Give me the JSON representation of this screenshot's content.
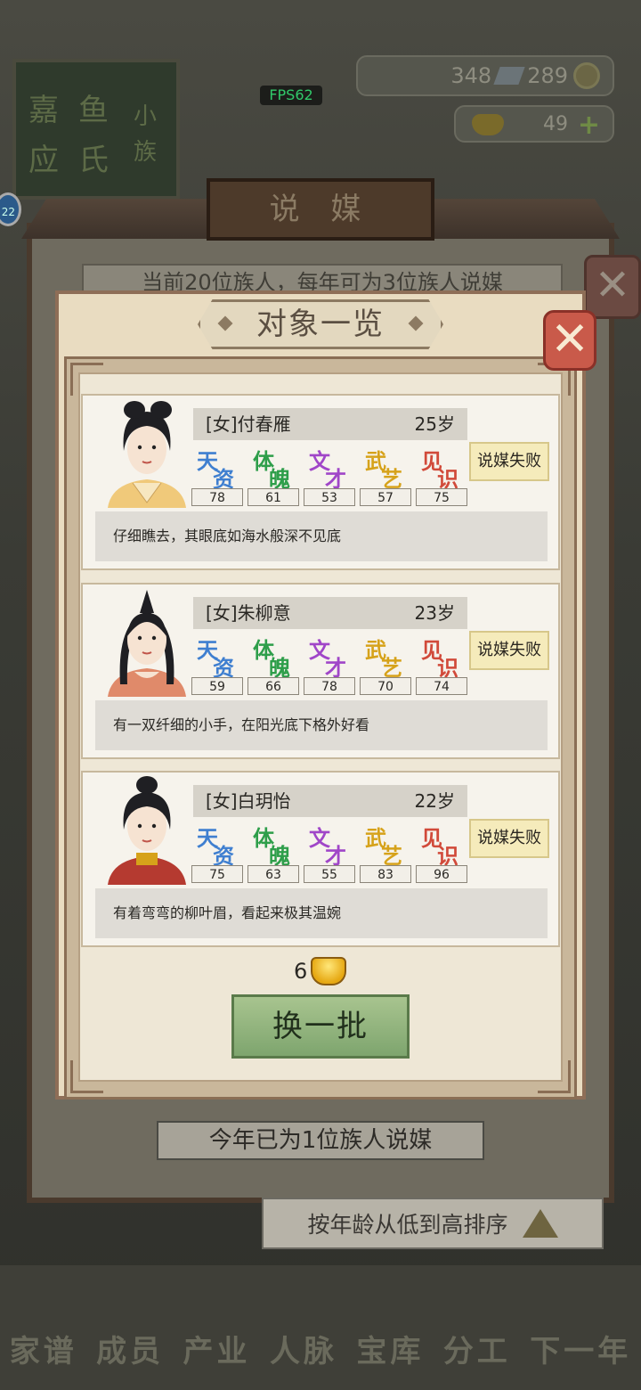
{
  "background": {
    "fps": "FPS62",
    "resources": {
      "copper": "348",
      "silver": "289",
      "gold": "49"
    },
    "plaque_chars": [
      "嘉",
      "鱼",
      "应",
      "氏",
      "小",
      "族"
    ],
    "badge": "22",
    "outer_title": "说 媒",
    "outer_subtitle": "当前20位族人，每年可为3位族人说媒",
    "outer_footer": "今年已为1位族人说媒",
    "sort_label": "按年龄从低到高排序",
    "nav": [
      "家谱",
      "成员",
      "产业",
      "人脉",
      "宝库",
      "分工",
      "下一年"
    ]
  },
  "dialog": {
    "title": "对象一览",
    "stat_labels": [
      {
        "a": "天",
        "b": "资",
        "color": "#3f7fd0"
      },
      {
        "a": "体",
        "b": "魄",
        "color": "#2e9e4a"
      },
      {
        "a": "文",
        "b": "才",
        "color": "#a046c8"
      },
      {
        "a": "武",
        "b": "艺",
        "color": "#d6a21a"
      },
      {
        "a": "见",
        "b": "识",
        "color": "#d14a3a"
      }
    ],
    "candidates": [
      {
        "name": "[女]付春雁",
        "age": "25岁",
        "stats": [
          "78",
          "61",
          "53",
          "57",
          "75"
        ],
        "status": "说媒失败",
        "desc": "仔细瞧去，其眼底如海水般深不见底"
      },
      {
        "name": "[女]朱柳意",
        "age": "23岁",
        "stats": [
          "59",
          "66",
          "78",
          "70",
          "74"
        ],
        "status": "说媒失败",
        "desc": "有一双纤细的小手，在阳光底下格外好看"
      },
      {
        "name": "[女]白玥怡",
        "age": "22岁",
        "stats": [
          "75",
          "63",
          "55",
          "83",
          "96"
        ],
        "status": "说媒失败",
        "desc": "有着弯弯的柳叶眉，看起来极其温婉"
      }
    ],
    "refresh_cost": "6",
    "refresh_label": "换一批"
  }
}
